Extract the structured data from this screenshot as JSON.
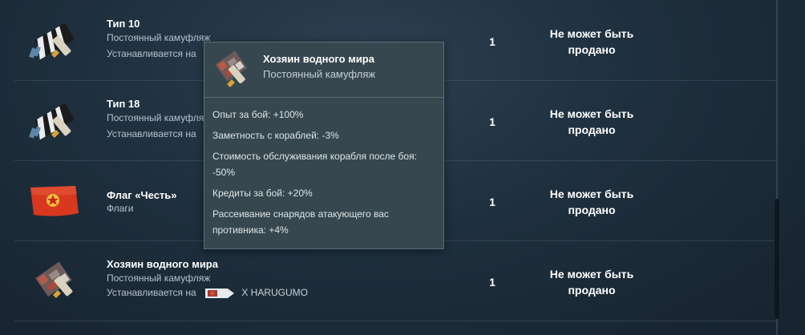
{
  "items": [
    {
      "title": "Тип 10",
      "subtitle": "Постоянный камуфляж",
      "install_label": "Устанавливается на",
      "quantity": "1",
      "sell_status": "Не может быть продано",
      "icon": "camouflage-icon"
    },
    {
      "title": "Тип 18",
      "subtitle": "Постоянный камуфляж",
      "install_label": "Устанавливается на",
      "quantity": "1",
      "sell_status": "Не может быть продано",
      "icon": "camouflage-icon"
    },
    {
      "title": "Флаг «Честь»",
      "subtitle": "Флаги",
      "quantity": "1",
      "sell_status": "Не может быть продано",
      "icon": "red-flag-icon"
    },
    {
      "title": "Хозяин водного мира",
      "subtitle": "Постоянный камуфляж",
      "install_label": "Устанавливается на",
      "ship_name": "X HARUGUMO",
      "quantity": "1",
      "sell_status": "Не может быть продано",
      "icon": "water-lord-camouflage-icon"
    }
  ],
  "tooltip": {
    "title": "Хозяин водного мира",
    "subtitle": "Постоянный камуфляж",
    "bonuses": [
      "Опыт за бой: +100%",
      "Заметность с кораблей: -3%",
      "Стоимость обслуживания корабля после боя: -50%",
      "Кредиты за бой: +20%",
      "Рассеивание снарядов атакующего вас противника: +4%"
    ]
  },
  "colors": {
    "background": "#1e2f3d",
    "tooltip_bg": "#36474f",
    "flag_red": "#d8381f"
  }
}
